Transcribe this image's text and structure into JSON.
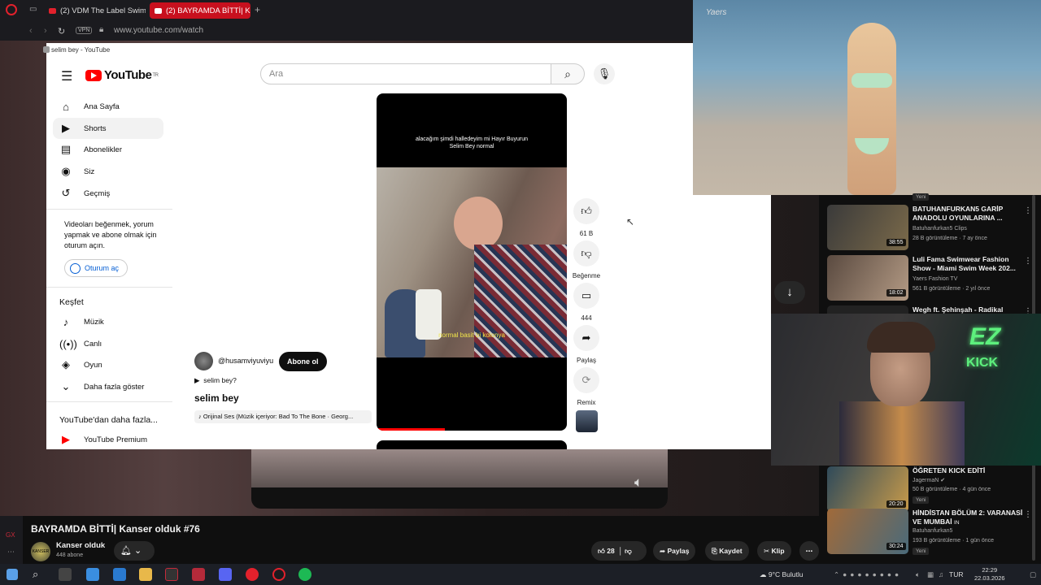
{
  "browser": {
    "tabs": [
      {
        "label": "(2) VDM The Label Swimw"
      },
      {
        "label": "(2) BAYRAMDA BİTTİ| Kan"
      }
    ],
    "new_tab_icon": "plus-icon",
    "vpn_label": "VPN",
    "url": "www.youtube.com/watch",
    "accent": "#e2212c"
  },
  "yt_window": {
    "title": "selim bey - YouTube",
    "logo_text": "YouTube",
    "logo_sup": "TR",
    "search_placeholder": "Ara",
    "nav": [
      {
        "label": "Ana Sayfa",
        "icon": "home-icon"
      },
      {
        "label": "Shorts",
        "icon": "shorts-icon"
      },
      {
        "label": "Abonelikler",
        "icon": "subscriptions-icon"
      },
      {
        "label": "Siz",
        "icon": "user-icon"
      },
      {
        "label": "Geçmiş",
        "icon": "history-icon"
      }
    ],
    "sign_prompt": "Videoları beğenmek, yorum yapmak ve abone olmak için oturum açın.",
    "sign_button": "Oturum aç",
    "explore_title": "Keşfet",
    "explore": [
      {
        "label": "Müzik",
        "icon": "music-icon"
      },
      {
        "label": "Canlı",
        "icon": "live-icon"
      },
      {
        "label": "Oyun",
        "icon": "gaming-icon"
      },
      {
        "label": "Daha fazla göster",
        "icon": "chevron-down-icon"
      }
    ],
    "more_title": "YouTube'dan daha fazla...",
    "premium": "YouTube Premium"
  },
  "short": {
    "caption_top": "alacağım şimdi halledeyim mi Hayır Buyurun Selim Bey normal",
    "subtitle": "normal basit bi kolonya",
    "progress": 0.36,
    "channel": "@husamviyuviyu",
    "subscribe": "Abone ol",
    "play_label": "selim bey?",
    "title": "selim bey",
    "audio": "Orijinal Ses (Müzik içeriyor: Bad To The Bone · Georg...",
    "actions": {
      "likes": "61 B",
      "dislike": "Beğenme",
      "comments": "444",
      "share": "Paylaş",
      "remix": "Remix"
    }
  },
  "runway": {
    "watermark": "Yaers"
  },
  "recs": [
    {
      "title": "BATUHANFURKAN5 GARİP ANADOLU OYUNLARINA ...",
      "channel": "Batuhanfurkan5 Clips",
      "meta": "28 B görüntüleme · 7 ay önce",
      "duration": "38:55",
      "thumb": "#6b5a3a"
    },
    {
      "title": "Luli Fama Swimwear Fashion Show - Miami Swim Week 202...",
      "channel": "Yaers Fashion TV",
      "meta": "561 B görüntüleme · 2 yıl önce",
      "duration": "18:02",
      "thumb": "#806a5a"
    },
    {
      "title": "Wegh ft. Şehinşah - Radikal",
      "channel": "",
      "meta": "",
      "duration": "",
      "thumb": "#222"
    },
    {
      "title": "ÖĞRETEN KICK EDİTİ",
      "channel": "JagermaN",
      "meta": "50 B görüntüleme · 4 gün önce",
      "duration": "20:20",
      "thumb": "#3f5a6a",
      "badge": "Yeni"
    },
    {
      "title": "HİNDİSTAN BÖLÜM 2: VARANASİ VE MUMBAİ",
      "title_suffix": "IN",
      "channel": "Batuhanfurkan5",
      "meta": "193 B görüntüleme · 1 gün önce",
      "duration": "30:24",
      "thumb": "#8a5a3a",
      "badge": "Yeni"
    }
  ],
  "rec_top_badge": "Yeni",
  "webcam": {
    "logo_top": "EZ",
    "logo_bottom": "KICK"
  },
  "stream": {
    "title": "BAYRAMDA BİTTİ| Kanser olduk #76",
    "channel": "Kanser olduk",
    "avatar_text": "KANSER OLDUK",
    "subs": "448 abone",
    "likes": "28",
    "share": "Paylaş",
    "save": "Kaydet",
    "clip": "Klip"
  },
  "taskbar": {
    "weather": "9°C  Bulutlu",
    "lang": "TUR",
    "time": "22:29",
    "date": "22.03.2026"
  }
}
